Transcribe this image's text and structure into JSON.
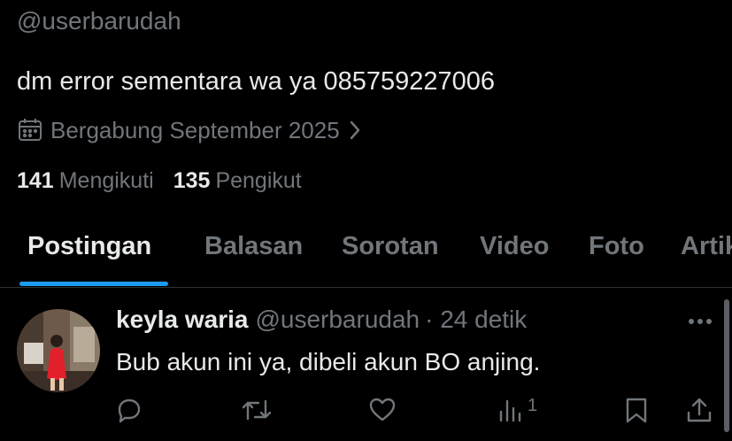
{
  "profile": {
    "handle": "@userbarudah",
    "bio": "dm error sementara wa ya 085759227006",
    "joined": "Bergabung September 2025",
    "following_count": "141",
    "following_label": "Mengikuti",
    "followers_count": "135",
    "followers_label": "Pengikut"
  },
  "tabs": [
    {
      "label": "Postingan",
      "active": true
    },
    {
      "label": "Balasan"
    },
    {
      "label": "Sorotan"
    },
    {
      "label": "Video"
    },
    {
      "label": "Foto"
    },
    {
      "label": "Artikel"
    }
  ],
  "post": {
    "display_name": "keyla waria",
    "handle": "@userbarudah",
    "time": "· 24 detik",
    "text": "Bub akun ini ya, dibeli akun BO anjing.",
    "views_count": "1"
  },
  "icons": {
    "calendar": "calendar-icon",
    "chevron": "chevron-right-icon",
    "more": "more-icon",
    "reply": "reply-icon",
    "repost": "repost-icon",
    "like": "heart-icon",
    "views": "views-icon",
    "bookmark": "bookmark-icon",
    "share": "share-icon"
  },
  "colors": {
    "background": "#000000",
    "text": "#e7e9ea",
    "muted": "#71767b",
    "accent": "#1d9bf0",
    "divider": "#2f3336"
  }
}
